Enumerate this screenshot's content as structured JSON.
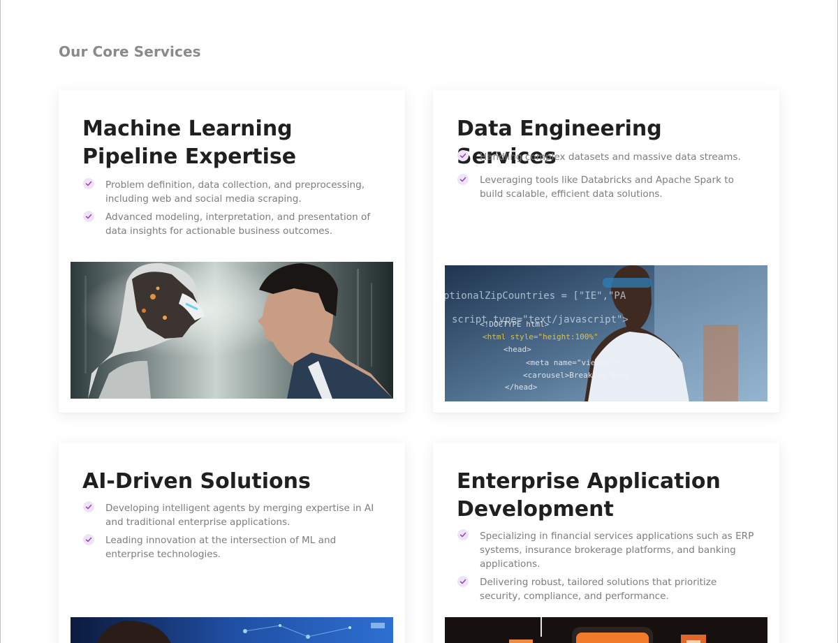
{
  "section": {
    "title": "Our Core Services"
  },
  "cards": [
    {
      "title": "Machine Learning Pipeline Expertise",
      "bullets": [
        "Problem definition, data collection, and preprocessing, including web and social media scraping.",
        "Advanced modeling, interpretation, and presentation of data insights for actionable business outcomes."
      ]
    },
    {
      "title": "Data Engineering Services",
      "bullets": [
        "Handling complex datasets and massive data streams.",
        "Leveraging tools like Databricks and Apache Spark to build scalable, efficient data solutions."
      ]
    },
    {
      "title": "AI-Driven Solutions",
      "bullets": [
        "Developing intelligent agents by merging expertise in AI and traditional enterprise applications.",
        "Leading innovation at the intersection of ML and enterprise technologies."
      ]
    },
    {
      "title": "Enterprise Application Development",
      "bullets": [
        "Specializing in financial services applications such as ERP systems, insurance brokerage platforms, and banking applications.",
        "Delivering robust, tailored solutions that prioritize security, compliance, and performance."
      ]
    }
  ],
  "code_overlay": {
    "lines": [
      "ptionalZipCountries = [\"IE\",\"PA",
      "script type=\"text/javascript\">",
      "<!DOCTYPE html>",
      "<html style=\"height:100%\"",
      "<head>",
      "<meta name=\"viewport\"",
      "<carousel>Breaking-News",
      "</head>"
    ]
  },
  "colors": {
    "accent_check_bg": "#efe4f7",
    "accent_check": "#8e44ad",
    "title": "#1f1f1f",
    "body_text": "#7d7d7d",
    "section_title": "#8a8a8a"
  },
  "icons": [
    "check-icon"
  ]
}
